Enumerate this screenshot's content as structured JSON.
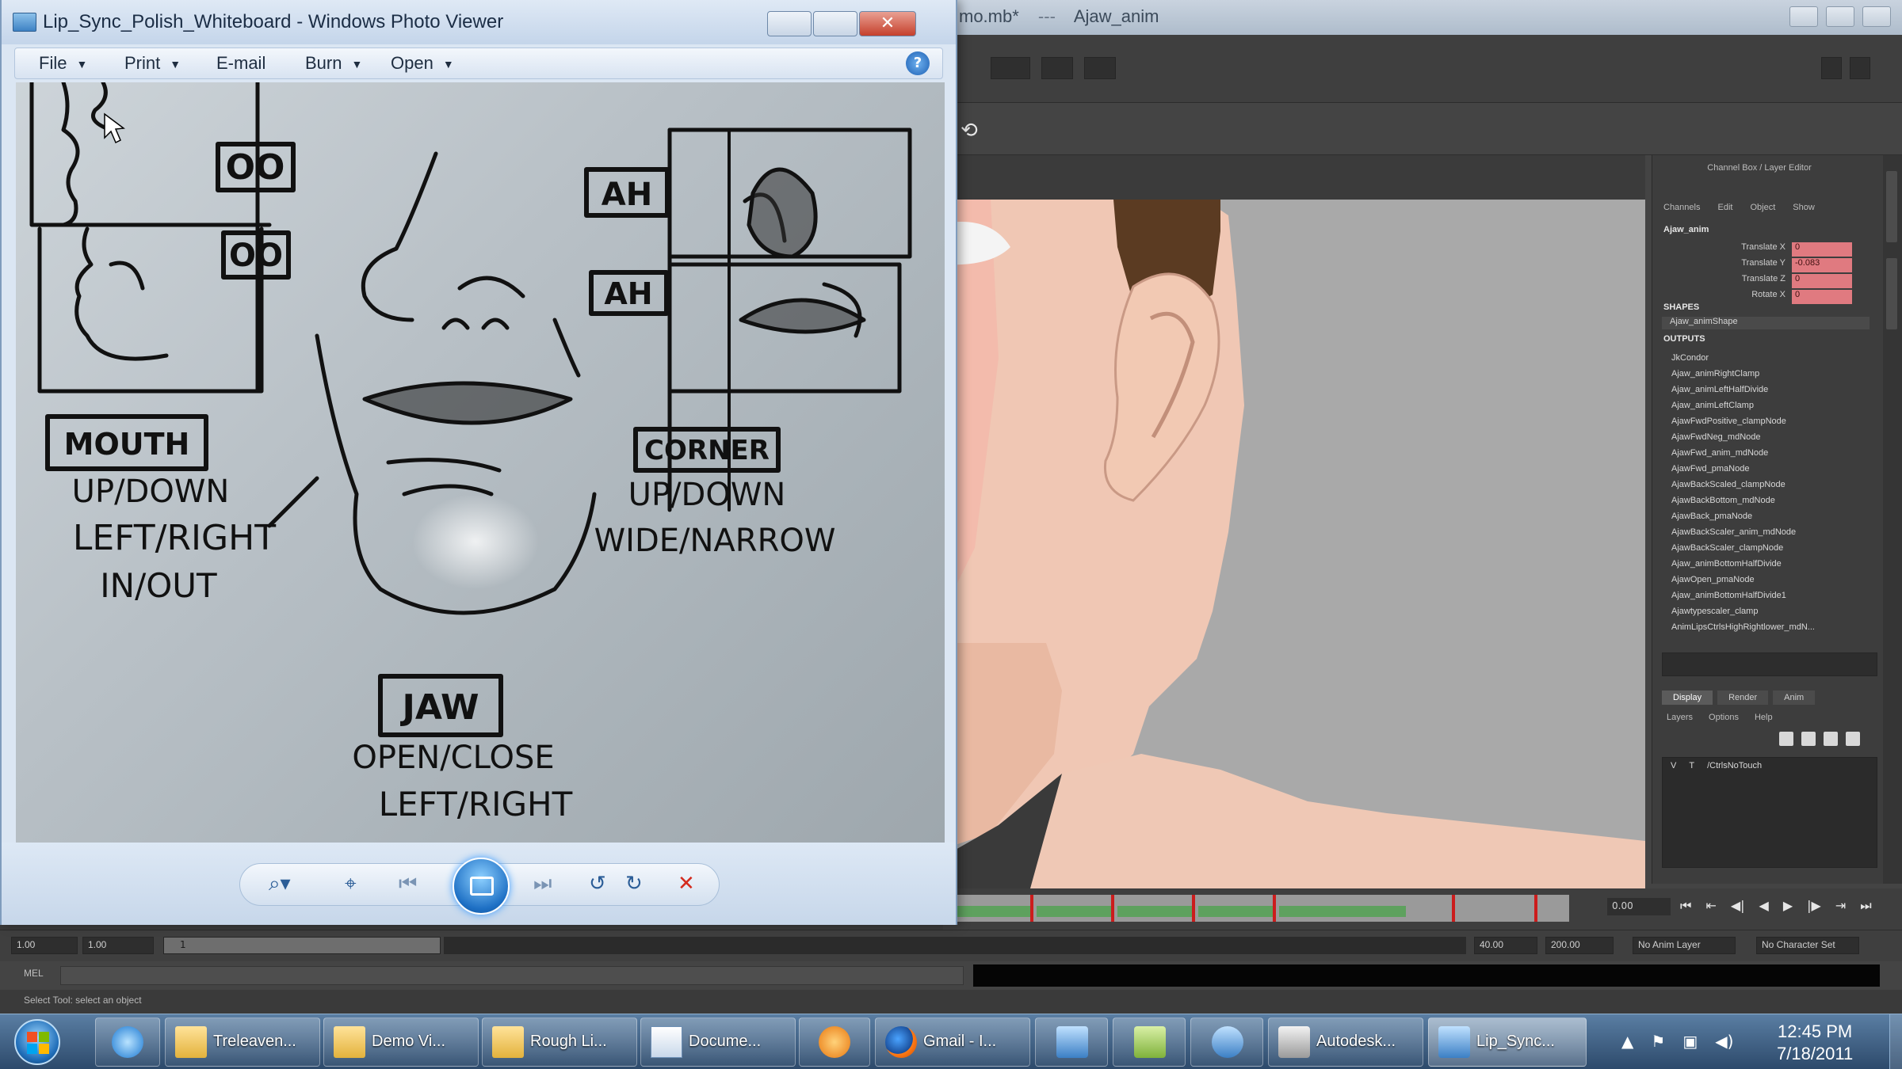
{
  "colors": {
    "photo_viewer_chrome": "#dbe6f3",
    "maya_panel": "#3d3d3d",
    "maya_viewport": "#a9a9a9",
    "channel_highlight": "#e07a80",
    "timeline_key": "#cc1c1c",
    "taskbar": "#2d4a6b"
  },
  "maya": {
    "title_file": "mo.mb*",
    "title_separator": "---",
    "title_object": "Ajaw_anim",
    "channel_box": {
      "title": "Channel Box / Layer Editor",
      "menu": [
        "Channels",
        "Edit",
        "Object",
        "Show"
      ],
      "object_name": "Ajaw_anim",
      "attributes": [
        {
          "name": "Translate X",
          "value": "0"
        },
        {
          "name": "Translate Y",
          "value": "-0.083"
        },
        {
          "name": "Translate Z",
          "value": "0"
        },
        {
          "name": "Rotate X",
          "value": "0"
        }
      ],
      "shapes_heading": "SHAPES",
      "shape_name": "Ajaw_animShape",
      "outputs_heading": "OUTPUTS",
      "outputs": [
        "JkCondor",
        "Ajaw_animRightClamp",
        "Ajaw_animLeftHalfDivide",
        "Ajaw_animLeftClamp",
        "AjawFwdPositive_clampNode",
        "AjawFwdNeg_mdNode",
        "AjawFwd_anim_mdNode",
        "AjawFwd_pmaNode",
        "AjawBackScaled_clampNode",
        "AjawBackBottom_mdNode",
        "AjawBack_pmaNode",
        "AjawBackScaler_anim_mdNode",
        "AjawBackScaler_clampNode",
        "Ajaw_animBottomHalfDivide",
        "AjawOpen_pmaNode",
        "Ajaw_animBottomHalfDivide1",
        "Ajawtypescaler_clamp",
        "AnimLipsCtrlsHighRightlower_mdN..."
      ],
      "layer_tabs": [
        "Display",
        "Render",
        "Anim"
      ],
      "layer_menu": [
        "Layers",
        "Options",
        "Help"
      ],
      "layer_row": {
        "v": "V",
        "t": "T",
        "name": "/CtrlsNoTouch"
      }
    },
    "timeline": {
      "current_frame": "0.00",
      "controls": [
        "⏮",
        "⇤",
        "◀|",
        "◀",
        "▶",
        "|▶",
        "⇥",
        "⏭"
      ]
    },
    "range": {
      "start": "1.00",
      "start_inner": "1.00",
      "slider_value": "1",
      "end_inner": "40.00",
      "end": "200.00",
      "anim_layer": "No Anim Layer",
      "char_set": "No Character Set"
    },
    "command_label": "MEL",
    "help_line": "Select Tool: select an object"
  },
  "photo_viewer": {
    "title": "Lip_Sync_Polish_Whiteboard - Windows Photo Viewer",
    "close_glyph": "✕",
    "menu": [
      {
        "label": "File",
        "caret": "▼"
      },
      {
        "label": "Print",
        "caret": "▼"
      },
      {
        "label": "E-mail",
        "caret": ""
      },
      {
        "label": "Burn",
        "caret": "▼"
      },
      {
        "label": "Open",
        "caret": "▼"
      }
    ],
    "help_glyph": "?",
    "whiteboard": {
      "label_oo_1": "OO",
      "label_oo_2": "OO",
      "label_ah_1": "AH",
      "label_ah_2": "AH",
      "mouth": {
        "title": "MOUTH",
        "lines": [
          "UP/DOWN",
          "LEFT/RIGHT",
          "IN/OUT"
        ]
      },
      "corner": {
        "title": "CORNER",
        "lines": [
          "UP/DOWN",
          "WIDE/NARROW"
        ]
      },
      "jaw": {
        "title": "JAW",
        "lines": [
          "OPEN/CLOSE",
          "LEFT/RIGHT"
        ]
      }
    },
    "controls": {
      "zoom": "⌕▾",
      "fit": "⌖",
      "prev": "⏮",
      "next": "⏭",
      "rotate_ccw": "↺",
      "rotate_cw": "↻",
      "delete": "✕"
    }
  },
  "taskbar": {
    "buttons": [
      {
        "label": "Treleaven..."
      },
      {
        "label": "Demo Vi..."
      },
      {
        "label": "Rough Li..."
      },
      {
        "label": "Docume..."
      },
      {
        "label": "Gmail - I..."
      },
      {
        "label": "Autodesk..."
      },
      {
        "label": "Lip_Sync..."
      }
    ],
    "tray_icons": [
      "▲",
      "⚑",
      "▣",
      "◀)"
    ],
    "time": "12:45 PM",
    "date": "7/18/2011"
  }
}
